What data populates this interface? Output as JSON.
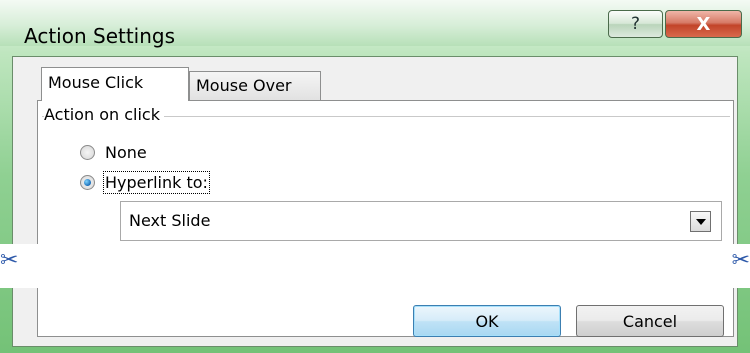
{
  "window": {
    "title": "Action Settings",
    "help_glyph": "?",
    "close_glyph": "X"
  },
  "tabs": [
    {
      "label": "Mouse Click",
      "active": true
    },
    {
      "label": "Mouse Over",
      "active": false
    }
  ],
  "action_group": {
    "label": "Action on click",
    "options": [
      {
        "label": "None",
        "selected": false
      },
      {
        "label": "Hyperlink to:",
        "selected": true
      }
    ],
    "hyperlink_value": "Next Slide"
  },
  "buttons": {
    "ok": "OK",
    "cancel": "Cancel"
  },
  "icons": {
    "cut_left": "scissors-icon",
    "cut_right": "scissors-icon"
  },
  "colors": {
    "titlebar": "#8fd092",
    "client_bg": "#f0f0f0",
    "close_button": "#c24429",
    "ok_button_border": "#3c7fb1"
  }
}
